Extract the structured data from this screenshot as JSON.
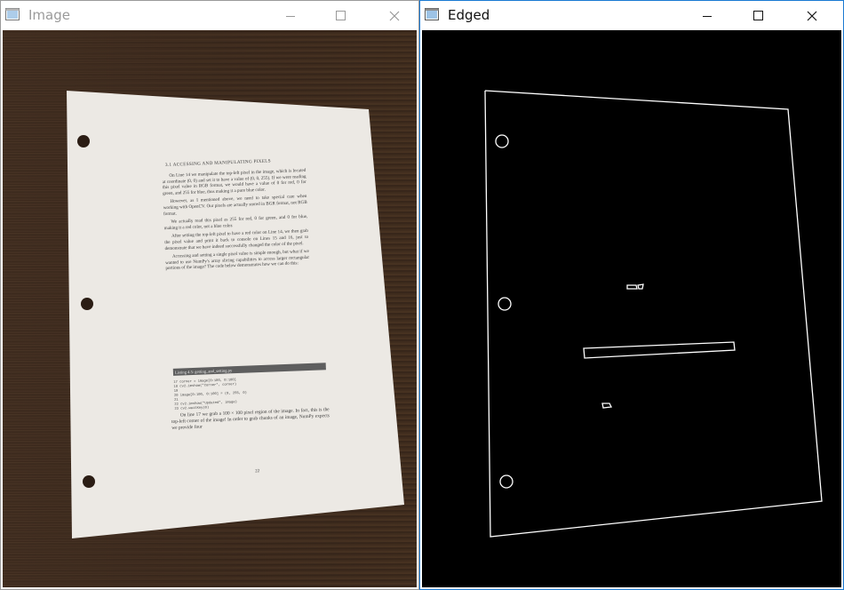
{
  "windows": [
    {
      "id": "image",
      "title": "Image",
      "active": false,
      "title_color": "#9a9a9a",
      "controls": [
        "minimize-icon",
        "maximize-icon",
        "close-icon"
      ],
      "content": "photo of a printed document page on a wooden table",
      "document": {
        "header": "3.1 ACCESSING AND MANIPULATING PIXELS",
        "paragraphs": [
          "On Line 14 we manipulate the top-left pixel in the image, which is located at coordinate (0, 0) and set it to have a value of (0, 0, 255). If we were reading this pixel value in RGB format, we would have a value of 0 for red, 0 for green, and 255 for blue, thus making it a pure blue color.",
          "However, as I mentioned above, we need to take special care when working with OpenCV. Our pixels are actually stored in BGR format, not RGB format.",
          "We actually read this pixel as 255 for red, 0 for green, and 0 for blue, making it a red color, not a blue color.",
          "After setting the top-left pixel to have a red color on Line 14, we then grab the pixel value and print it back to console on Lines 15 and 16, just to demonstrate that we have indeed successfully changed the color of the pixel.",
          "Accessing and setting a single pixel value is simple enough, but what if we wanted to use NumPy's array slicing capabilities to access larger rectangular portions of the image? The code below demonstrates how we can do this:"
        ],
        "listing_title": "Listing 4.5: getting_and_setting.py",
        "code_lines": [
          "17 corner = image[0:100, 0:100]",
          "18 cv2.imshow(\"Corner\", corner)",
          "19",
          "20 image[0:100, 0:100] = (0, 255, 0)",
          "21",
          "22 cv2.imshow(\"Updated\", image)",
          "23 cv2.waitKey(0)"
        ],
        "closing_paragraph": "On line 17 we grab a 100 × 100 pixel region of the image. In fact, this is the top-left corner of the image! In order to grab chunks of an image, NumPy expects we provide four",
        "page_number": "22"
      }
    },
    {
      "id": "edged",
      "title": "Edged",
      "active": true,
      "title_color": "#111111",
      "controls": [
        "minimize-icon",
        "maximize-icon",
        "close-icon"
      ],
      "content": "white edge-detection outline of the document on a black background"
    }
  ],
  "colors": {
    "edge_line": "#ffffff",
    "edged_background": "#000000",
    "paper": "#ece9e4",
    "wood": "#3e2b1e",
    "active_border": "#1a7ad3",
    "inactive_border": "#9a9a9a"
  }
}
